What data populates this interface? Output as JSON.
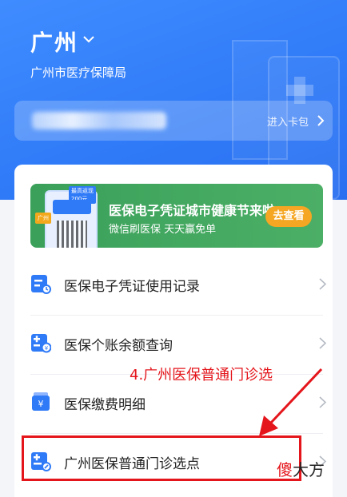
{
  "header": {
    "city": "广州",
    "bureau": "广州市医疗保障局"
  },
  "card": {
    "link_label": "进入卡包"
  },
  "banner": {
    "title": "医保电子凭证城市健康节来啦",
    "subtitle": "微信刷医保 天天赢免单",
    "button_label": "去查看",
    "phone_tag": "最高返现200元",
    "pin_label": "广州"
  },
  "menu": {
    "items": [
      {
        "label": "医保电子凭证使用记录",
        "icon": "record-icon"
      },
      {
        "label": "医保个账余额查询",
        "icon": "balance-icon"
      },
      {
        "label": "医保缴费明细",
        "icon": "payment-icon"
      },
      {
        "label": "广州医保普通门诊选点",
        "icon": "clinic-select-icon"
      }
    ]
  },
  "annotation": {
    "text": "4.广州医保普通门诊选",
    "color": "#e4161c"
  },
  "watermark": {
    "char1": "傻",
    "char2": "大方"
  },
  "colors": {
    "primary": "#2f7af7",
    "banner_green": "#3aa05a",
    "button_orange": "#f5a623",
    "annotation_red": "#e4161c"
  }
}
